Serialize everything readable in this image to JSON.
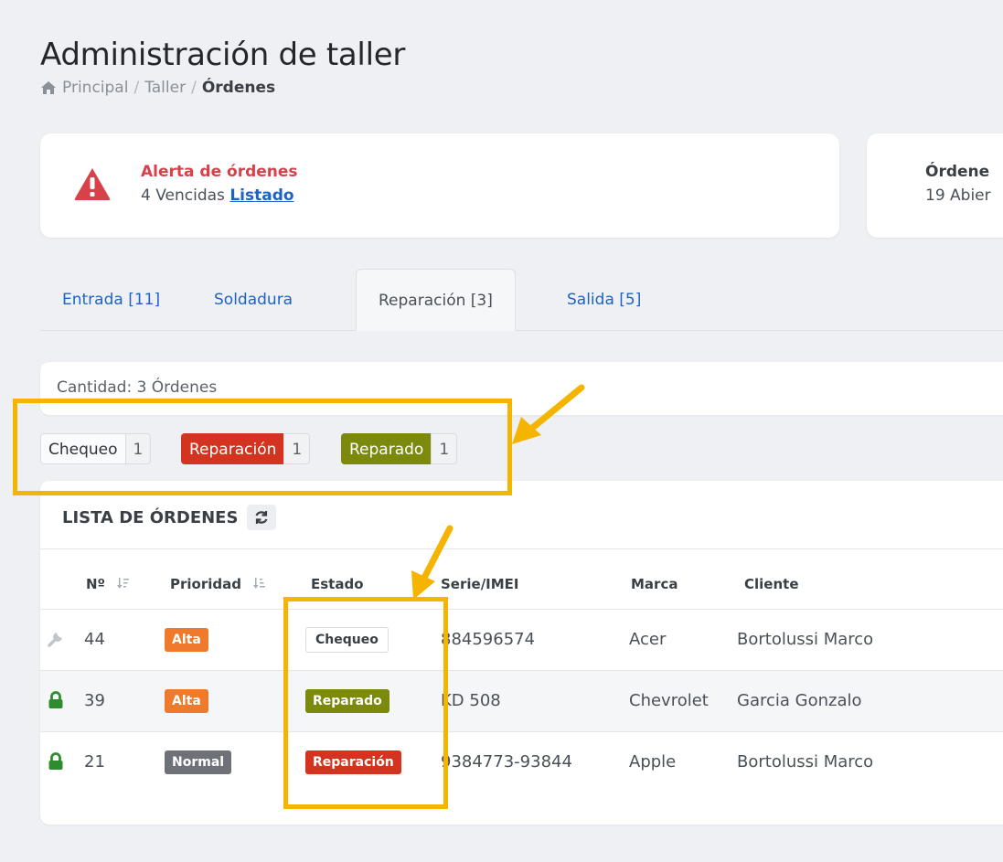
{
  "header": {
    "title": "Administración de taller",
    "breadcrumb": {
      "home": "Principal",
      "sep": "/",
      "taller": "Taller",
      "current": "Órdenes"
    }
  },
  "alert_card": {
    "title": "Alerta de órdenes",
    "count_text": "4 Vencidas",
    "link": "Listado",
    "icon": "warning-triangle-icon",
    "color": "#d9414a"
  },
  "open_card": {
    "title": "Órdene",
    "subtitle": "19 Abier"
  },
  "tabs": [
    {
      "label": "Entrada [11]"
    },
    {
      "label": "Soldadura"
    },
    {
      "label": "Reparación [3]",
      "active": true
    },
    {
      "label": "Salida [5]"
    }
  ],
  "summary": {
    "quantity_text": "Cantidad: 3 Órdenes"
  },
  "status_counts": [
    {
      "label": "Chequeo",
      "count": "1",
      "color": "#fafbfc"
    },
    {
      "label": "Reparación",
      "count": "1",
      "color": "#d4341f"
    },
    {
      "label": "Reparado",
      "count": "1",
      "color": "#7b8a0d"
    }
  ],
  "list": {
    "title": "LISTA DE ÓRDENES",
    "columns": {
      "numero": "Nº",
      "prioridad": "Prioridad",
      "estado": "Estado",
      "serie": "Serie/IMEI",
      "marca": "Marca",
      "cliente": "Cliente"
    },
    "rows": [
      {
        "icon": "wrench-icon",
        "numero": "44",
        "prioridad": "Alta",
        "estado": "Chequeo",
        "serie": "884596574",
        "marca": "Acer",
        "cliente": "Bortolussi Marco"
      },
      {
        "icon": "lock-icon",
        "numero": "39",
        "prioridad": "Alta",
        "estado": "Reparado",
        "serie": "KD 508",
        "marca": "Chevrolet",
        "cliente": "Garcia Gonzalo"
      },
      {
        "icon": "lock-icon",
        "numero": "21",
        "prioridad": "Normal",
        "estado": "Reparación",
        "serie": "9384773-93844",
        "marca": "Apple",
        "cliente": "Bortolussi Marco"
      }
    ]
  },
  "colors": {
    "link": "#1c63c6",
    "alta": "#ef7a2b",
    "normal": "#6e7278",
    "highlight": "#f5b400"
  }
}
